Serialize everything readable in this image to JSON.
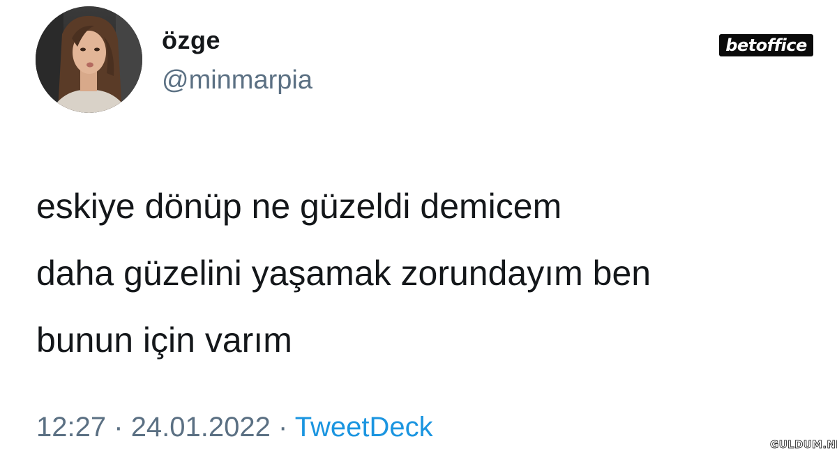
{
  "user": {
    "display_name": "özge",
    "handle": "@minmarpia"
  },
  "brand_badge": "betoffice",
  "tweet": {
    "lines": [
      "eskiye dönüp ne güzeldi demicem",
      "daha güzelini yaşamak zorundayım ben",
      "bunun için varım"
    ]
  },
  "meta": {
    "time": "12:27",
    "separator": "·",
    "date": "24.01.2022",
    "source": "TweetDeck"
  },
  "watermark": "GULDUM.NET",
  "colors": {
    "text": "#14171a",
    "muted": "#5b7083",
    "link": "#1b95e0",
    "background": "#ffffff"
  }
}
